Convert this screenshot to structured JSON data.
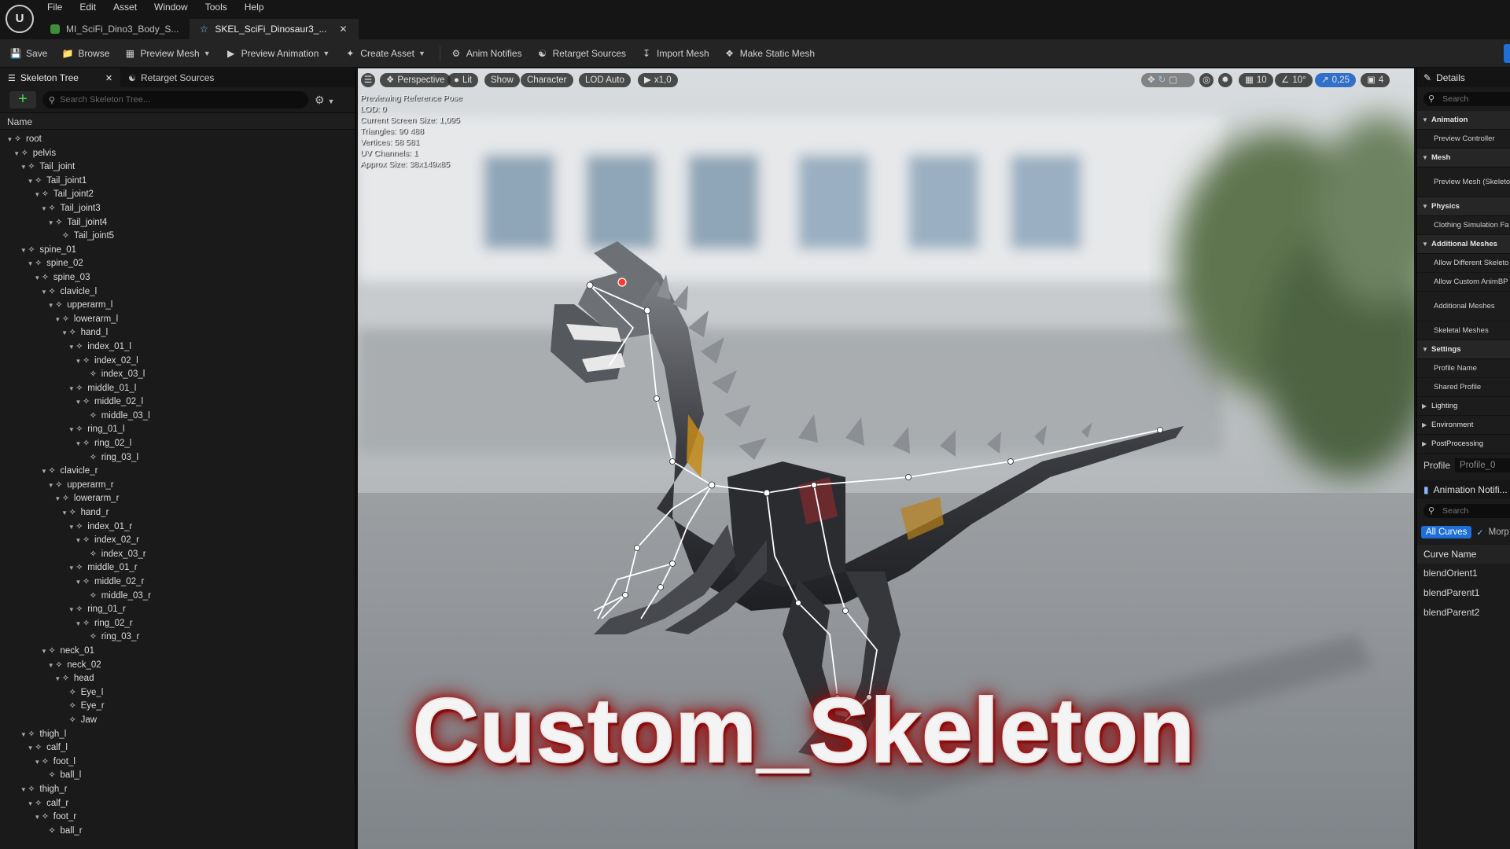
{
  "menu": [
    "File",
    "Edit",
    "Asset",
    "Window",
    "Tools",
    "Help"
  ],
  "tabs": [
    {
      "label": "MI_SciFi_Dino3_Body_S...",
      "icon": "material-instance-icon",
      "active": false
    },
    {
      "label": "SKEL_SciFi_Dinosaur3_...",
      "icon": "skeleton-icon",
      "active": true
    }
  ],
  "toolbar": {
    "save": "Save",
    "browse": "Browse",
    "preview_mesh": "Preview Mesh",
    "preview_animation": "Preview Animation",
    "create_asset": "Create Asset",
    "anim_notifies": "Anim Notifies",
    "retarget_sources": "Retarget Sources",
    "import_mesh": "Import Mesh",
    "make_static_mesh": "Make Static Mesh"
  },
  "left_panel": {
    "tab_skeleton_tree": "Skeleton Tree",
    "tab_retarget_sources": "Retarget Sources",
    "search_placeholder": "Search Skeleton Tree...",
    "column_name": "Name",
    "bones": [
      {
        "name": "root",
        "depth": 0
      },
      {
        "name": "pelvis",
        "depth": 1
      },
      {
        "name": "Tail_joint",
        "depth": 2
      },
      {
        "name": "Tail_joint1",
        "depth": 3
      },
      {
        "name": "Tail_joint2",
        "depth": 4
      },
      {
        "name": "Tail_joint3",
        "depth": 5
      },
      {
        "name": "Tail_joint4",
        "depth": 6
      },
      {
        "name": "Tail_joint5",
        "depth": 7
      },
      {
        "name": "spine_01",
        "depth": 2
      },
      {
        "name": "spine_02",
        "depth": 3
      },
      {
        "name": "spine_03",
        "depth": 4
      },
      {
        "name": "clavicle_l",
        "depth": 5
      },
      {
        "name": "upperarm_l",
        "depth": 6
      },
      {
        "name": "lowerarm_l",
        "depth": 7
      },
      {
        "name": "hand_l",
        "depth": 8
      },
      {
        "name": "index_01_l",
        "depth": 9
      },
      {
        "name": "index_02_l",
        "depth": 10
      },
      {
        "name": "index_03_l",
        "depth": 11
      },
      {
        "name": "middle_01_l",
        "depth": 9
      },
      {
        "name": "middle_02_l",
        "depth": 10
      },
      {
        "name": "middle_03_l",
        "depth": 11
      },
      {
        "name": "ring_01_l",
        "depth": 9
      },
      {
        "name": "ring_02_l",
        "depth": 10
      },
      {
        "name": "ring_03_l",
        "depth": 11
      },
      {
        "name": "clavicle_r",
        "depth": 5
      },
      {
        "name": "upperarm_r",
        "depth": 6
      },
      {
        "name": "lowerarm_r",
        "depth": 7
      },
      {
        "name": "hand_r",
        "depth": 8
      },
      {
        "name": "index_01_r",
        "depth": 9
      },
      {
        "name": "index_02_r",
        "depth": 10
      },
      {
        "name": "index_03_r",
        "depth": 11
      },
      {
        "name": "middle_01_r",
        "depth": 9
      },
      {
        "name": "middle_02_r",
        "depth": 10
      },
      {
        "name": "middle_03_r",
        "depth": 11
      },
      {
        "name": "ring_01_r",
        "depth": 9
      },
      {
        "name": "ring_02_r",
        "depth": 10
      },
      {
        "name": "ring_03_r",
        "depth": 11
      },
      {
        "name": "neck_01",
        "depth": 5
      },
      {
        "name": "neck_02",
        "depth": 6
      },
      {
        "name": "head",
        "depth": 7
      },
      {
        "name": "Eye_l",
        "depth": 8
      },
      {
        "name": "Eye_r",
        "depth": 8
      },
      {
        "name": "Jaw",
        "depth": 8
      },
      {
        "name": "thigh_l",
        "depth": 2
      },
      {
        "name": "calf_l",
        "depth": 3
      },
      {
        "name": "foot_l",
        "depth": 4
      },
      {
        "name": "ball_l",
        "depth": 5
      },
      {
        "name": "thigh_r",
        "depth": 2
      },
      {
        "name": "calf_r",
        "depth": 3
      },
      {
        "name": "foot_r",
        "depth": 4
      },
      {
        "name": "ball_r",
        "depth": 5
      }
    ]
  },
  "viewport": {
    "perspective": "Perspective",
    "lit": "Lit",
    "show": "Show",
    "character": "Character",
    "lod": "LOD Auto",
    "speed": "x1,0",
    "right_controls": {
      "grid": "10",
      "angle": "10°",
      "scale": "0,25",
      "camera": "4"
    },
    "stats": [
      "Previewing Reference Pose",
      "LOD: 0",
      "Current Screen Size: 1,095",
      "Triangles: 90 488",
      "Vertices: 58 581",
      "UV Channels: 1",
      "Approx Size: 38x149x85"
    ],
    "overlay_title": "Custom_Skeleton"
  },
  "details": {
    "title": "Details",
    "search_placeholder": "Search",
    "sections": [
      {
        "category": "Animation",
        "expanded": true,
        "props": [
          "Preview Controller"
        ]
      },
      {
        "category": "Mesh",
        "expanded": true,
        "props": [
          "Preview Mesh (Skeleton)"
        ]
      },
      {
        "category": "Physics",
        "expanded": true,
        "props": [
          "Clothing Simulation Fa"
        ]
      },
      {
        "category": "Additional Meshes",
        "expanded": true,
        "props": [
          "Allow Different Skeleto",
          "Allow Custom AnimBP",
          "Additional Meshes",
          "Skeletal Meshes"
        ]
      },
      {
        "category": "Settings",
        "expanded": true,
        "props": [
          "Profile Name",
          "Shared Profile"
        ]
      },
      {
        "category": "Lighting",
        "expanded": false,
        "props": []
      },
      {
        "category": "Environment",
        "expanded": false,
        "props": []
      },
      {
        "category": "PostProcessing",
        "expanded": false,
        "props": []
      }
    ],
    "profile_label": "Profile",
    "profile_value": "Profile_0"
  },
  "anim_curves": {
    "title": "Animation Notifi...",
    "search_placeholder": "Search",
    "filter_all": "All Curves",
    "filter_morph": "Morp",
    "column": "Curve Name",
    "curves": [
      "blendOrient1",
      "blendParent1",
      "blendParent2"
    ]
  },
  "colors": {
    "accent": "#1e6fd6",
    "add_green": "#4fcf4f",
    "title_glow": "#b01010"
  }
}
